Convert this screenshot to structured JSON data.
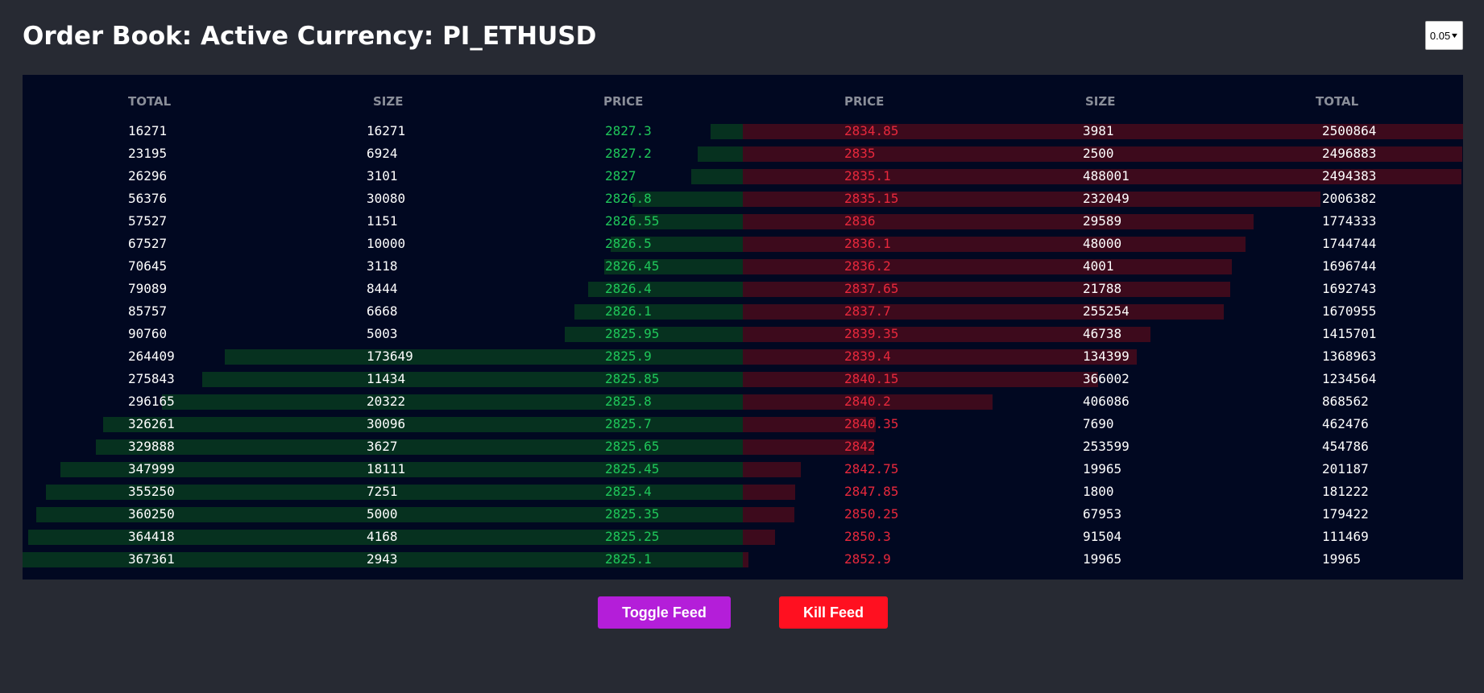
{
  "header": {
    "title": "Order Book: Active Currency: PI_ETHUSD",
    "grouping_value": "0.05"
  },
  "columns": {
    "bid_total": "TOTAL",
    "bid_size": "SIZE",
    "bid_price": "PRICE",
    "ask_price": "PRICE",
    "ask_size": "SIZE",
    "ask_total": "TOTAL"
  },
  "rows": [
    {
      "bid_total": "16271",
      "bid_size": "16271",
      "bid_price": "2827.3",
      "ask_price": "2834.85",
      "ask_size": "3981",
      "ask_total": "2500864"
    },
    {
      "bid_total": "23195",
      "bid_size": "6924",
      "bid_price": "2827.2",
      "ask_price": "2835",
      "ask_size": "2500",
      "ask_total": "2496883"
    },
    {
      "bid_total": "26296",
      "bid_size": "3101",
      "bid_price": "2827",
      "ask_price": "2835.1",
      "ask_size": "488001",
      "ask_total": "2494383"
    },
    {
      "bid_total": "56376",
      "bid_size": "30080",
      "bid_price": "2826.8",
      "ask_price": "2835.15",
      "ask_size": "232049",
      "ask_total": "2006382"
    },
    {
      "bid_total": "57527",
      "bid_size": "1151",
      "bid_price": "2826.55",
      "ask_price": "2836",
      "ask_size": "29589",
      "ask_total": "1774333"
    },
    {
      "bid_total": "67527",
      "bid_size": "10000",
      "bid_price": "2826.5",
      "ask_price": "2836.1",
      "ask_size": "48000",
      "ask_total": "1744744"
    },
    {
      "bid_total": "70645",
      "bid_size": "3118",
      "bid_price": "2826.45",
      "ask_price": "2836.2",
      "ask_size": "4001",
      "ask_total": "1696744"
    },
    {
      "bid_total": "79089",
      "bid_size": "8444",
      "bid_price": "2826.4",
      "ask_price": "2837.65",
      "ask_size": "21788",
      "ask_total": "1692743"
    },
    {
      "bid_total": "85757",
      "bid_size": "6668",
      "bid_price": "2826.1",
      "ask_price": "2837.7",
      "ask_size": "255254",
      "ask_total": "1670955"
    },
    {
      "bid_total": "90760",
      "bid_size": "5003",
      "bid_price": "2825.95",
      "ask_price": "2839.35",
      "ask_size": "46738",
      "ask_total": "1415701"
    },
    {
      "bid_total": "264409",
      "bid_size": "173649",
      "bid_price": "2825.9",
      "ask_price": "2839.4",
      "ask_size": "134399",
      "ask_total": "1368963"
    },
    {
      "bid_total": "275843",
      "bid_size": "11434",
      "bid_price": "2825.85",
      "ask_price": "2840.15",
      "ask_size": "366002",
      "ask_total": "1234564"
    },
    {
      "bid_total": "296165",
      "bid_size": "20322",
      "bid_price": "2825.8",
      "ask_price": "2840.2",
      "ask_size": "406086",
      "ask_total": "868562"
    },
    {
      "bid_total": "326261",
      "bid_size": "30096",
      "bid_price": "2825.7",
      "ask_price": "2840.35",
      "ask_size": "7690",
      "ask_total": "462476"
    },
    {
      "bid_total": "329888",
      "bid_size": "3627",
      "bid_price": "2825.65",
      "ask_price": "2842",
      "ask_size": "253599",
      "ask_total": "454786"
    },
    {
      "bid_total": "347999",
      "bid_size": "18111",
      "bid_price": "2825.45",
      "ask_price": "2842.75",
      "ask_size": "19965",
      "ask_total": "201187"
    },
    {
      "bid_total": "355250",
      "bid_size": "7251",
      "bid_price": "2825.4",
      "ask_price": "2847.85",
      "ask_size": "1800",
      "ask_total": "181222"
    },
    {
      "bid_total": "360250",
      "bid_size": "5000",
      "bid_price": "2825.35",
      "ask_price": "2850.25",
      "ask_size": "67953",
      "ask_total": "179422"
    },
    {
      "bid_total": "364418",
      "bid_size": "4168",
      "bid_price": "2825.25",
      "ask_price": "2850.3",
      "ask_size": "91504",
      "ask_total": "111469"
    },
    {
      "bid_total": "367361",
      "bid_size": "2943",
      "bid_price": "2825.1",
      "ask_price": "2852.9",
      "ask_size": "19965",
      "ask_total": "19965"
    }
  ],
  "colors": {
    "background": "#272a33",
    "book_background": "#010821",
    "bid_text": "#1fc75a",
    "ask_text": "#e8283c",
    "bid_bar": "#06311f",
    "ask_bar": "#3d0a1c",
    "toggle_button": "#b41ed9",
    "kill_button": "#ff1020"
  },
  "actions": {
    "toggle_label": "Toggle Feed",
    "kill_label": "Kill Feed"
  }
}
